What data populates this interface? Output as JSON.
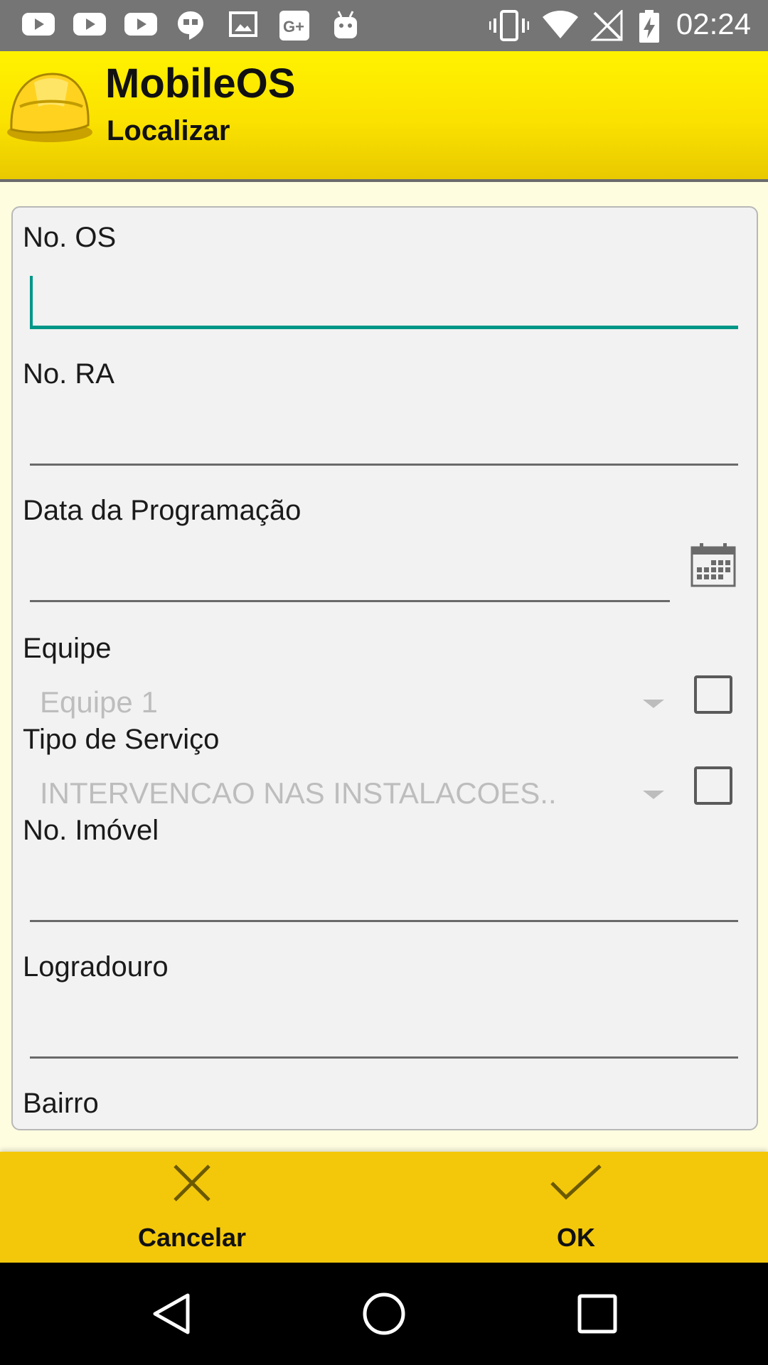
{
  "status_bar": {
    "time": "02:24",
    "left_icons": [
      "youtube-icon",
      "youtube-icon",
      "youtube-icon",
      "hangouts-icon",
      "gallery-icon",
      "google-plus-icon",
      "android-icon"
    ],
    "right_icons": [
      "vibrate-icon",
      "wifi-icon",
      "no-signal-icon",
      "battery-charging-icon"
    ]
  },
  "header": {
    "title": "MobileOS",
    "subtitle": "Localizar",
    "logo": "hard-hat-icon"
  },
  "form": {
    "os_label": "No. OS",
    "os_value": "",
    "ra_label": "No. RA",
    "ra_value": "",
    "date_label": "Data da Programação",
    "date_value": "",
    "equipe_label": "Equipe",
    "equipe_value": "Equipe 1",
    "equipe_checked": false,
    "tipo_label": "Tipo de Serviço",
    "tipo_value": "INTERVENCAO NAS INSTALACOES..",
    "tipo_checked": false,
    "imovel_label": "No. Imóvel",
    "imovel_value": "",
    "logradouro_label": "Logradouro",
    "logradouro_value": "",
    "bairro_label": "Bairro"
  },
  "actions": {
    "cancel_label": "Cancelar",
    "ok_label": "OK"
  },
  "colors": {
    "header_yellow": "#fbe200",
    "action_bar": "#f4c80a",
    "accent": "#009688"
  }
}
